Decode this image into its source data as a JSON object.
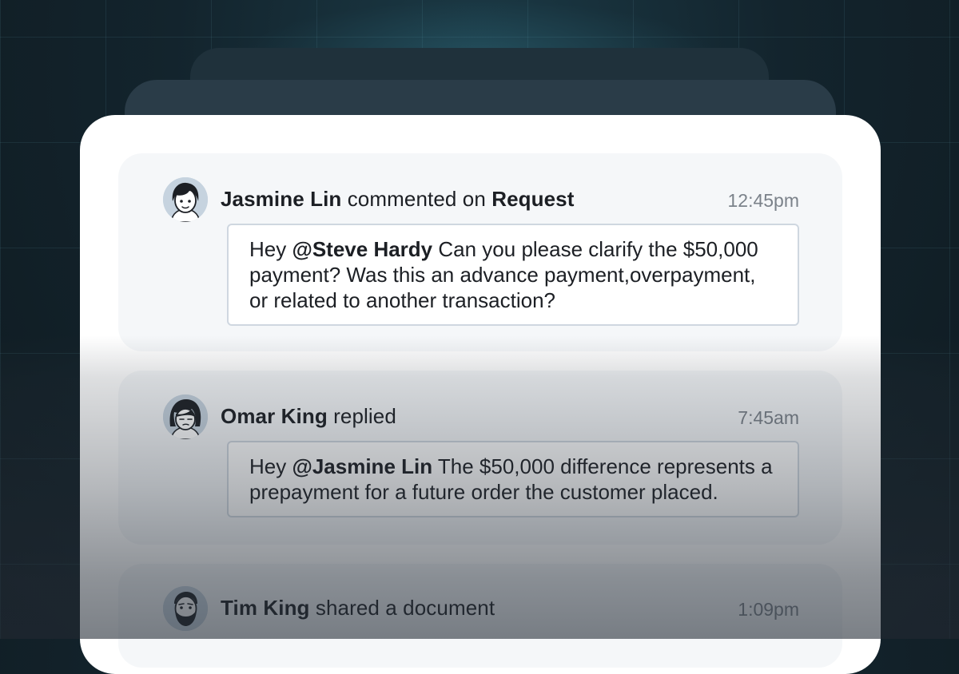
{
  "feed": {
    "items": [
      {
        "author": "Jasmine Lin",
        "action": "commented on",
        "target": "Request",
        "time": "12:45pm",
        "message_prefix": "Hey",
        "mention": "@Steve Hardy",
        "message_body": "Can you please clarify the $50,000 payment? Was this an advance payment,overpayment, or related to another transaction?",
        "avatar": "avatar-woman-short-hair"
      },
      {
        "author": "Omar King",
        "action": "replied",
        "time": "7:45am",
        "message_prefix": "Hey",
        "mention": "@Jasmine Lin",
        "message_body": "The $50,000 difference represents a prepayment for a future order the customer placed.",
        "avatar": "avatar-person-bob-hair"
      },
      {
        "author": "Tim King",
        "action": "shared a document",
        "time": "1:09pm",
        "avatar": "avatar-man-beard"
      }
    ]
  },
  "colors": {
    "background": "#13242d",
    "panel": "#ffffff",
    "card": "#f5f7f9",
    "bubble_border": "#cfd7e0",
    "text": "#1c1f24",
    "muted_text": "#7b828a",
    "avatar_bg": "#c6d3df"
  }
}
